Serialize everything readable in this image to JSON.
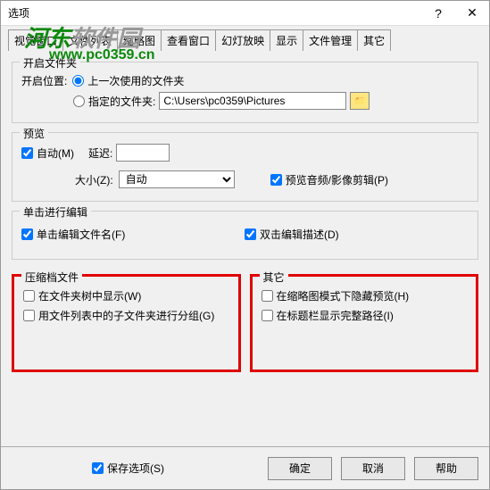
{
  "window": {
    "title": "选项"
  },
  "watermark": {
    "left": "河东",
    "right": "软件园",
    "url": "www.pc0359.cn"
  },
  "tabs": [
    "视觉窗口",
    "文件列表",
    "缩略图",
    "查看窗口",
    "幻灯放映",
    "显示",
    "文件管理",
    "其它"
  ],
  "openFolder": {
    "legend": "开启文件夹",
    "locLabel": "开启位置:",
    "opt1": "上一次使用的文件夹",
    "opt2": "指定的文件夹:",
    "path": "C:\\Users\\pc0359\\Pictures"
  },
  "preview": {
    "legend": "预览",
    "auto": "自动(M)",
    "delayLabel": "延迟:",
    "delayValue": "",
    "sizeLabel": "大小(Z):",
    "sizeValue": "自动",
    "mediaClip": "预览音频/影像剪辑(P)"
  },
  "clickEdit": {
    "legend": "单击进行编辑",
    "editName": "单击编辑文件名(F)",
    "dblDesc": "双击编辑描述(D)"
  },
  "archive": {
    "legend": "压缩档文件",
    "showTree": "在文件夹树中显示(W)",
    "groupSub": "用文件列表中的子文件夹进行分组(G)"
  },
  "other": {
    "legend": "其它",
    "hideThumb": "在缩略图模式下隐藏预览(H)",
    "fullPath": "在标题栏显示完整路径(I)"
  },
  "footer": {
    "saveOpt": "保存选项(S)",
    "ok": "确定",
    "cancel": "取消",
    "help": "帮助"
  }
}
